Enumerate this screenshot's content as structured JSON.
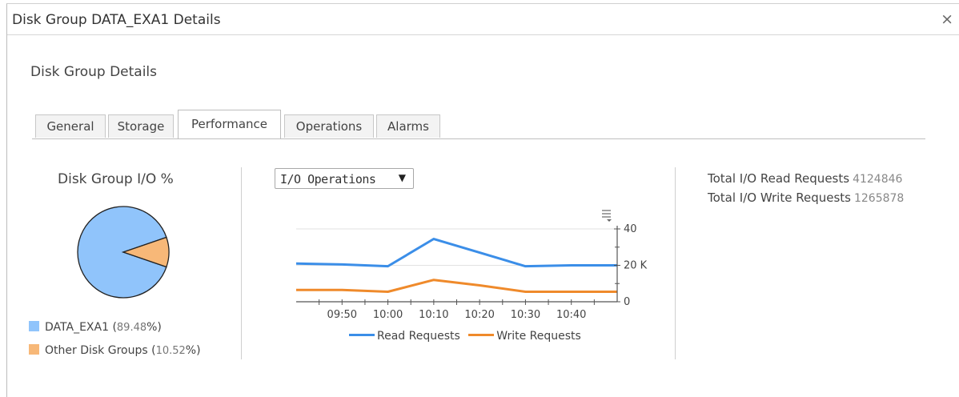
{
  "window": {
    "title": "Disk Group DATA_EXA1 Details",
    "close_symbol": "×"
  },
  "section_title": "Disk Group Details",
  "tabs": [
    {
      "label": "General",
      "active": false
    },
    {
      "label": "Storage",
      "active": false
    },
    {
      "label": "Performance",
      "active": true
    },
    {
      "label": "Operations",
      "active": false
    },
    {
      "label": "Alarms",
      "active": false
    }
  ],
  "pie": {
    "title": "Disk Group I/O %",
    "legend": [
      {
        "label": "DATA_EXA1 (",
        "pct": "89.48",
        "suffix": "%)",
        "color": "#90c4fb"
      },
      {
        "label": "Other Disk Groups (",
        "pct": "10.52",
        "suffix": "%)",
        "color": "#f7b878"
      }
    ]
  },
  "metric_select": {
    "value": "I/O Operations",
    "arrow": "▼"
  },
  "chart_menu_icon": "chart-menu-icon",
  "chart_data": {
    "type": "line",
    "x": [
      "09:45",
      "09:50",
      "10:00",
      "10:10",
      "10:20",
      "10:30",
      "10:40",
      "10:50"
    ],
    "x_tick_labels": [
      "09:50",
      "10:00",
      "10:10",
      "10:20",
      "10:30",
      "10:40"
    ],
    "y_tick_labels": [
      "40",
      "20 K",
      "0"
    ],
    "ylim": [
      0,
      40000
    ],
    "grid": true,
    "legend_position": "bottom",
    "series": [
      {
        "name": "Read Requests",
        "color": "#3b8ee8",
        "values": [
          21000,
          20500,
          19500,
          34500,
          27000,
          19500,
          20000,
          20000
        ]
      },
      {
        "name": "Write Requests",
        "color": "#ef8a2b",
        "values": [
          6500,
          6500,
          5500,
          12000,
          9000,
          5500,
          5500,
          5500
        ]
      }
    ]
  },
  "stats": [
    {
      "label": "Total I/O Read Requests",
      "value": "4124846"
    },
    {
      "label": "Total I/O Write Requests",
      "value": "1265878"
    }
  ]
}
